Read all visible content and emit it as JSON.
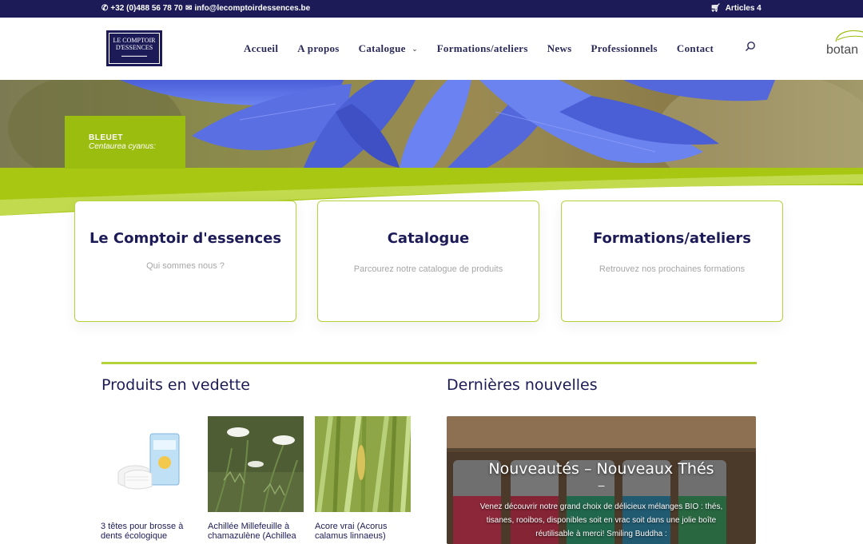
{
  "topbar": {
    "phone": "+32 (0)488 56 78 70",
    "email": "info@lecomptoirdessences.be",
    "cart": "Articles 4"
  },
  "logo": {
    "line1": "LE COMPTOIR",
    "line2": "D'ESSENCES"
  },
  "nav": {
    "items": [
      "Accueil",
      "A propos",
      "Catalogue",
      "Formations/ateliers",
      "News",
      "Professionnels",
      "Contact"
    ]
  },
  "partner": {
    "text": "botan"
  },
  "hero": {
    "caption_title": "BLEUET",
    "caption_subtitle": "Centaurea cyanus:"
  },
  "cards": [
    {
      "title": "Le Comptoir d'essences",
      "subtitle": "Qui sommes nous ?"
    },
    {
      "title": "Catalogue",
      "subtitle": "Parcourez notre catalogue de produits"
    },
    {
      "title": "Formations/ateliers",
      "subtitle": "Retrouvez nos prochaines formations"
    }
  ],
  "featured": {
    "title": "Produits en vedette",
    "products": [
      {
        "name": "3 têtes pour brosse à dents écologique"
      },
      {
        "name": "Achillée Millefeuille à chamazulène (Achillea"
      },
      {
        "name": "Acore vrai (Acorus calamus linnaeus)"
      }
    ]
  },
  "news": {
    "title": "Dernières nouvelles",
    "item_title": "Nouveautés – Nouveaux Thés",
    "item_dash": "–",
    "item_body": "Venez découvrir notre grand choix de délicieux mélanges BIO : thés, tisanes, rooibos, disponibles soit en vrac  soit dans une jolie boîte réutilisable à merci! Smiling Buddha :"
  },
  "colors": {
    "navy": "#1c1b57",
    "green": "#9bbd0f",
    "card_border": "#b4d23a"
  }
}
